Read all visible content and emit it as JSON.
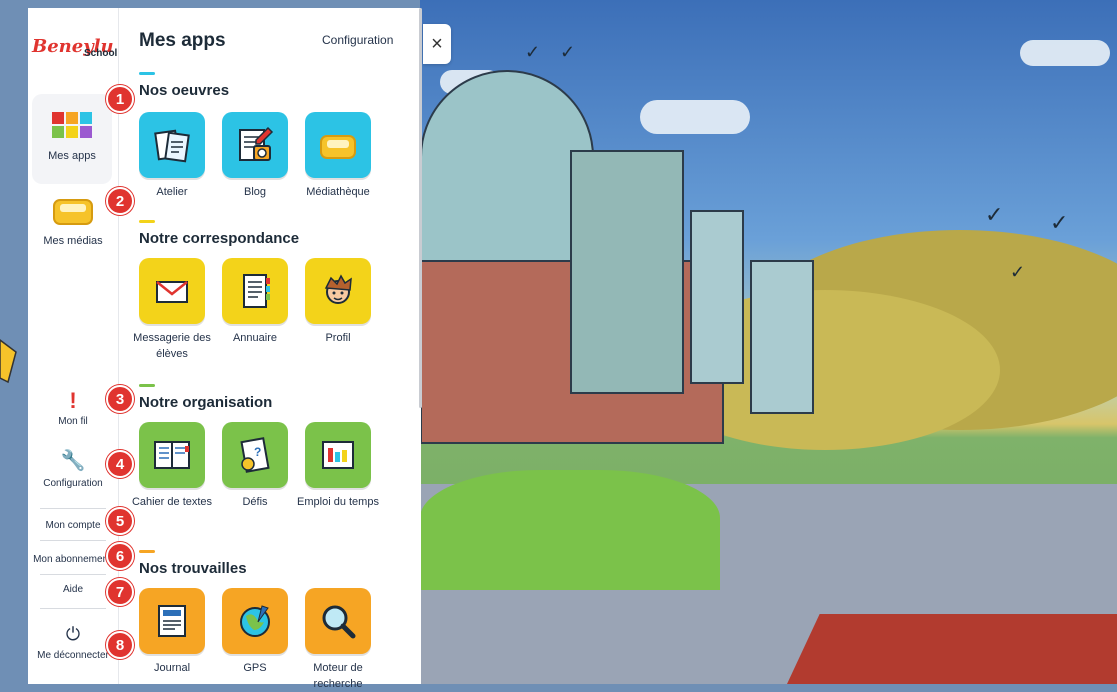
{
  "brand": {
    "logo_text": "Beneylu",
    "logo_sub": "School"
  },
  "leftnav": {
    "mes_apps": "Mes apps",
    "mes_medias": "Mes médias",
    "mon_fil": "Mon fil",
    "configuration": "Configuration",
    "mon_compte": "Mon compte",
    "mon_abonnement": "Mon abonnement",
    "aide": "Aide",
    "deconnecter": "Me déconnecter"
  },
  "panel": {
    "title": "Mes apps",
    "config_link": "Configuration",
    "close_glyph": "×"
  },
  "sections": [
    {
      "title": "Nos oeuvres",
      "accent": "#2cc3e5",
      "apps": [
        {
          "label": "Atelier",
          "icon": "atelier-icon",
          "color": "#2cc3e5"
        },
        {
          "label": "Blog",
          "icon": "blog-icon",
          "color": "#2cc3e5"
        },
        {
          "label": "Médiathèque",
          "icon": "mediatheque-icon",
          "color": "#2cc3e5"
        }
      ]
    },
    {
      "title": "Notre correspondance",
      "accent": "#f3d31a",
      "apps": [
        {
          "label": "Messagerie des élèves",
          "icon": "mail-icon",
          "color": "#f3d31a"
        },
        {
          "label": "Annuaire",
          "icon": "annuaire-icon",
          "color": "#f3d31a"
        },
        {
          "label": "Profil",
          "icon": "profil-icon",
          "color": "#f3d31a"
        }
      ]
    },
    {
      "title": "Notre organisation",
      "accent": "#7bc24a",
      "apps": [
        {
          "label": "Cahier de textes",
          "icon": "cahier-icon",
          "color": "#7bc24a"
        },
        {
          "label": "Défis",
          "icon": "defis-icon",
          "color": "#7bc24a"
        },
        {
          "label": "Emploi du temps",
          "icon": "emploi-icon",
          "color": "#7bc24a"
        }
      ]
    },
    {
      "title": "Nos trouvailles",
      "accent": "#f6a524",
      "apps": [
        {
          "label": "Journal",
          "icon": "journal-icon",
          "color": "#f6a524"
        },
        {
          "label": "GPS",
          "icon": "gps-icon",
          "color": "#f6a524"
        },
        {
          "label": "Moteur de recherche",
          "icon": "search-icon",
          "color": "#f6a524"
        }
      ]
    }
  ],
  "badges": [
    "1",
    "2",
    "3",
    "4",
    "5",
    "6",
    "7",
    "8"
  ],
  "colors": {
    "badge": "#e0342f",
    "text": "#1d2b38"
  }
}
